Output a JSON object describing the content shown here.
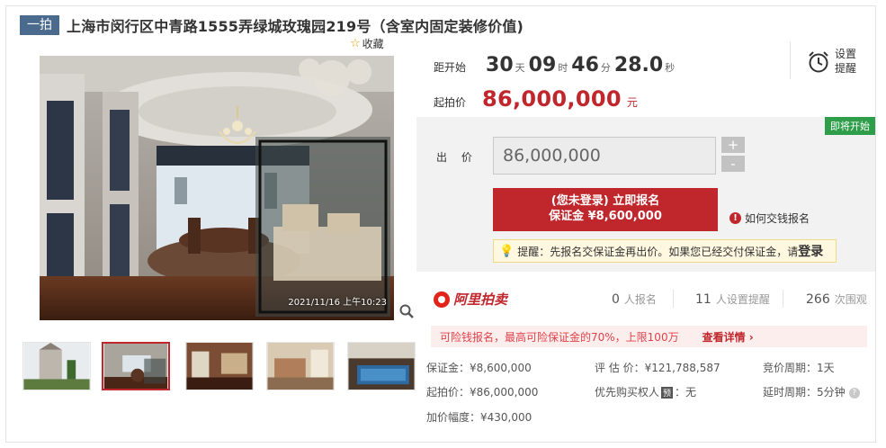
{
  "title_tag": "一拍",
  "title": "上海市闵行区中青路1555弄绿城玫瑰园219号（含室内固定装修价值)",
  "favorite_label": "收藏",
  "photo_timestamp": "2021/11/16 上午10:23",
  "countdown": {
    "label": "距开始",
    "days": "30",
    "days_unit": "天",
    "hours": "09",
    "hours_unit": "时",
    "minutes": "46",
    "minutes_unit": "分",
    "seconds": "28.0",
    "seconds_unit": "秒"
  },
  "reminder": {
    "line1": "设置",
    "line2": "提醒"
  },
  "start_price": {
    "label": "起拍价",
    "value": "86,000,000",
    "unit": "元"
  },
  "status_badge": "即将开始",
  "bid": {
    "label": "出 价",
    "input_value": "86,000,000",
    "plus": "+",
    "minus": "-",
    "register_line1": "(您未登录) 立即报名",
    "register_line2": "保证金 ¥8,600,000",
    "how_pay": "如何交钱报名",
    "hint_text": "提醒：先报名交保证金再出价。如果您已经交付保证金，请",
    "hint_login": "登录"
  },
  "platform_name": "阿里拍卖",
  "stats": [
    {
      "num": "0",
      "unit": "人报名"
    },
    {
      "num": "11",
      "unit": "人设置提醒"
    },
    {
      "num": "266",
      "unit": "次围观"
    }
  ],
  "loan": {
    "text": "可险钱报名，最高可险保证金的70%，上限100万",
    "link": "查看详情 ›"
  },
  "details": {
    "deposit": "保证金：¥8,600,000",
    "appraisal": "评 估 价：¥121,788,587",
    "bid_cycle": "竞价周期：1天",
    "start_price": "起拍价：¥86,000,000",
    "priority_label": "优先购买权人",
    "priority_tag": "预",
    "priority_value": "：无",
    "delay_cycle": "延时周期：5分钟",
    "increment": "加价幅度：¥430,000"
  },
  "colors": {
    "accent": "#c0272d",
    "badge_green": "#2e9e4a",
    "tag_blue": "#4a6a8e"
  },
  "icons": [
    "star-icon",
    "zoom-icon",
    "alarm-clock-icon",
    "info-icon",
    "bulb-icon",
    "aliauction-logo-icon",
    "help-icon"
  ]
}
